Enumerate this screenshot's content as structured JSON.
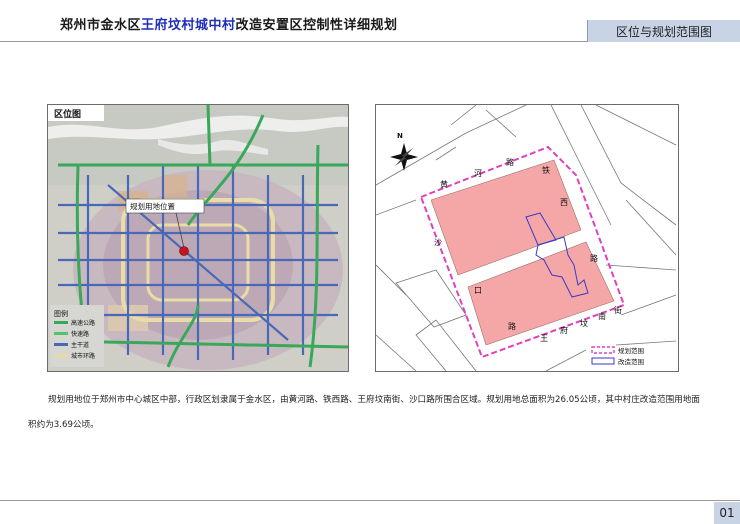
{
  "header": {
    "title_part1": "郑州市金水区",
    "title_highlight": "王府坟村城中村",
    "title_part2": "改造安置区控制性详细规划",
    "section_tab": "区位与规划范围图"
  },
  "location_map": {
    "title": "区位图",
    "site_label": "规划用地位置",
    "legend_title": "图例",
    "legend_items": [
      {
        "label": "高速公路",
        "color": "#3aa85a"
      },
      {
        "label": "快速路",
        "color": "#4fc46a"
      },
      {
        "label": "主干道",
        "color": "#4a68b8"
      },
      {
        "label": "城市环路",
        "color": "#e9d9a3"
      }
    ]
  },
  "site_map": {
    "north_label": "N",
    "roads": {
      "huanghe": [
        "黄",
        "河",
        "路"
      ],
      "tiexi": [
        "铁",
        "西",
        "路"
      ],
      "shakou": [
        "沙",
        "口",
        "路"
      ],
      "wangfufen": [
        "王",
        "府",
        "坟",
        "南",
        "街"
      ]
    },
    "legend": [
      {
        "label": "规划范围",
        "color": "#e040c0"
      },
      {
        "label": "改造范围",
        "color": "#3a3ac8"
      }
    ]
  },
  "description": "规划用地位于郑州市中心城区中部，行政区划隶属于金水区，由黄河路、铁西路、王府坟南街、沙口路所围合区域。规划用地总面积为26.05公顷，其中村庄改造范围用地面积约为3.69公顷。",
  "page_number": "01"
}
